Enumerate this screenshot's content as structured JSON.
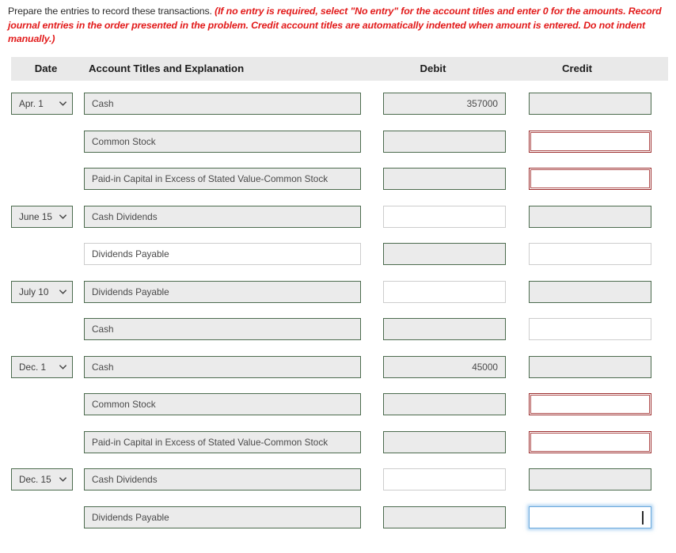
{
  "instructions": {
    "lead": "Prepare the entries to record these transactions.",
    "emphasis": "(If no entry is required, select \"No entry\" for the account titles and enter 0 for the amounts. Record journal entries in the order presented in the problem. Credit account titles are automatically indented when amount is entered. Do not indent manually.)"
  },
  "table": {
    "headers": {
      "date": "Date",
      "account": "Account Titles and Explanation",
      "debit": "Debit",
      "credit": "Credit"
    },
    "rows": [
      {
        "date": "Apr. 1",
        "has_date": true,
        "account": "Cash",
        "account_state": "filled",
        "debit": "357000",
        "debit_state": "filled",
        "credit": "",
        "credit_state": "filled"
      },
      {
        "date": "",
        "has_date": false,
        "account": "Common Stock",
        "account_state": "filled",
        "debit": "",
        "debit_state": "filled",
        "credit": "",
        "credit_state": "error"
      },
      {
        "date": "",
        "has_date": false,
        "account": "Paid-in Capital in Excess of Stated Value-Common Stock",
        "account_state": "filled",
        "debit": "",
        "debit_state": "filled",
        "credit": "",
        "credit_state": "error"
      },
      {
        "date": "June 15",
        "has_date": true,
        "account": "Cash Dividends",
        "account_state": "filled",
        "debit": "",
        "debit_state": "empty",
        "credit": "",
        "credit_state": "filled"
      },
      {
        "date": "",
        "has_date": false,
        "account": "Dividends Payable",
        "account_state": "empty",
        "debit": "",
        "debit_state": "filled",
        "credit": "",
        "credit_state": "empty"
      },
      {
        "date": "July 10",
        "has_date": true,
        "account": "Dividends Payable",
        "account_state": "filled",
        "debit": "",
        "debit_state": "empty",
        "credit": "",
        "credit_state": "filled"
      },
      {
        "date": "",
        "has_date": false,
        "account": "Cash",
        "account_state": "filled",
        "debit": "",
        "debit_state": "filled",
        "credit": "",
        "credit_state": "empty"
      },
      {
        "date": "Dec. 1",
        "has_date": true,
        "account": "Cash",
        "account_state": "filled",
        "debit": "45000",
        "debit_state": "filled",
        "credit": "",
        "credit_state": "filled"
      },
      {
        "date": "",
        "has_date": false,
        "account": "Common Stock",
        "account_state": "filled",
        "debit": "",
        "debit_state": "filled",
        "credit": "",
        "credit_state": "error"
      },
      {
        "date": "",
        "has_date": false,
        "account": "Paid-in Capital in Excess of Stated Value-Common Stock",
        "account_state": "filled",
        "debit": "",
        "debit_state": "filled",
        "credit": "",
        "credit_state": "error"
      },
      {
        "date": "Dec. 15",
        "has_date": true,
        "account": "Cash Dividends",
        "account_state": "filled",
        "debit": "",
        "debit_state": "empty",
        "credit": "",
        "credit_state": "filled"
      },
      {
        "date": "",
        "has_date": false,
        "account": "Dividends Payable",
        "account_state": "filled",
        "debit": "",
        "debit_state": "filled",
        "credit": "",
        "credit_state": "focused"
      }
    ]
  },
  "colors": {
    "error_border": "#9b2c2c",
    "focus_border": "#6aa8dd",
    "filled_border": "#4c6b4e",
    "filled_background": "#ebebeb",
    "instruction_emphasis": "#e21b1b",
    "header_background": "#e9e9e9"
  },
  "icons": {
    "chevron_down": "chevron-down-icon"
  }
}
